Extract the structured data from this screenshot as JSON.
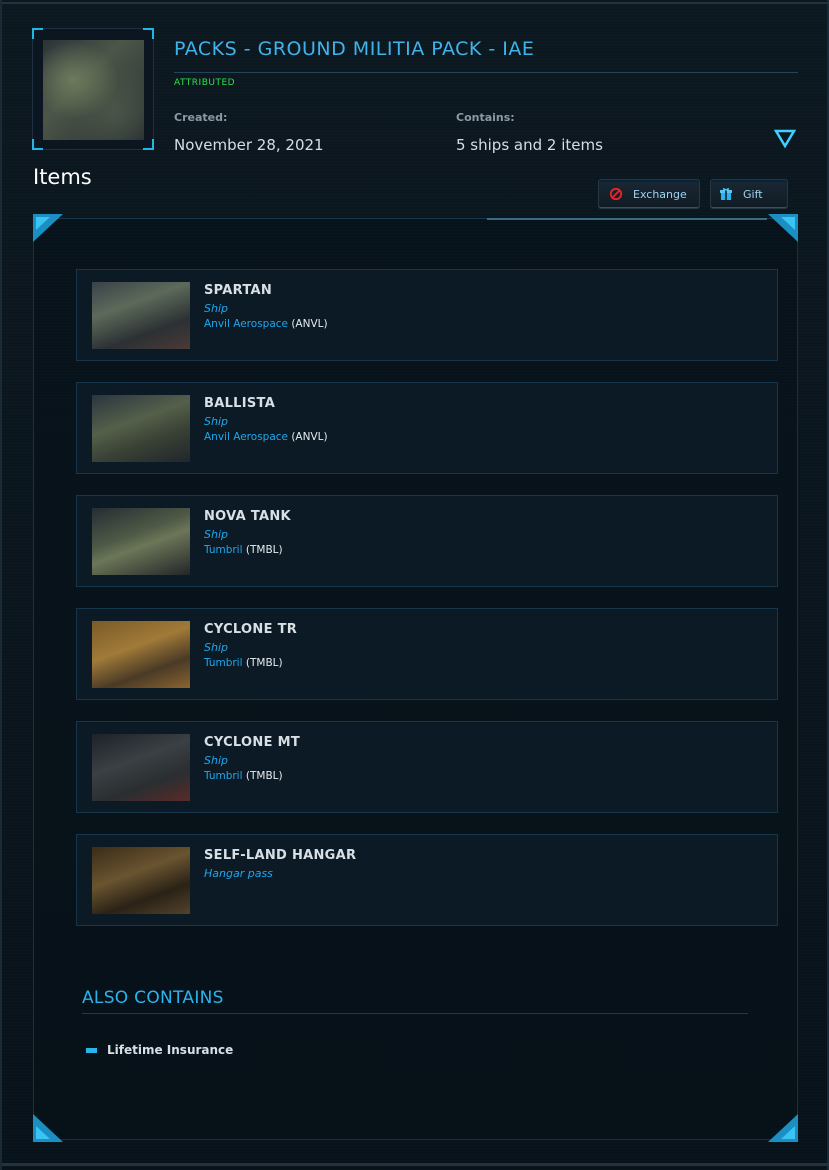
{
  "pack": {
    "title": "PACKS - GROUND MILITIA PACK - IAE",
    "status": "ATTRIBUTED",
    "created_label": "Created:",
    "created_value": "November 28, 2021",
    "contains_label": "Contains:",
    "contains_value": "5 ships and 2 items"
  },
  "section": {
    "items_heading": "Items"
  },
  "actions": {
    "exchange_label": "Exchange",
    "gift_label": "Gift"
  },
  "items": [
    {
      "name": "SPARTAN",
      "kind": "Ship",
      "maker": "Anvil Aerospace",
      "maker_code": " (ANVL)"
    },
    {
      "name": "BALLISTA",
      "kind": "Ship",
      "maker": "Anvil Aerospace",
      "maker_code": " (ANVL)"
    },
    {
      "name": "NOVA TANK",
      "kind": "Ship",
      "maker": "Tumbril",
      "maker_code": " (TMBL)"
    },
    {
      "name": "CYCLONE TR",
      "kind": "Ship",
      "maker": "Tumbril",
      "maker_code": " (TMBL)"
    },
    {
      "name": "CYCLONE MT",
      "kind": "Ship",
      "maker": "Tumbril",
      "maker_code": " (TMBL)"
    },
    {
      "name": "SELF-LAND HANGAR",
      "kind": "Hangar pass",
      "maker": "",
      "maker_code": ""
    }
  ],
  "also_contains": {
    "title": "ALSO CONTAINS",
    "entries": [
      "Lifetime Insurance"
    ]
  },
  "colors": {
    "accent": "#2ab4ee",
    "status_green": "#2ee04a",
    "background": "#0a141c"
  }
}
